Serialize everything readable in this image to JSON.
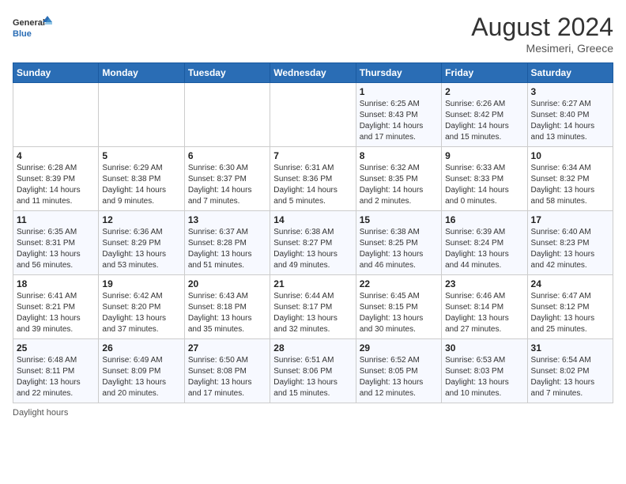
{
  "header": {
    "logo": {
      "general": "General",
      "blue": "Blue"
    },
    "title": "August 2024",
    "location": "Mesimeri, Greece"
  },
  "days_of_week": [
    "Sunday",
    "Monday",
    "Tuesday",
    "Wednesday",
    "Thursday",
    "Friday",
    "Saturday"
  ],
  "weeks": [
    [
      {
        "day": "",
        "info": ""
      },
      {
        "day": "",
        "info": ""
      },
      {
        "day": "",
        "info": ""
      },
      {
        "day": "",
        "info": ""
      },
      {
        "day": "1",
        "info": "Sunrise: 6:25 AM\nSunset: 8:43 PM\nDaylight: 14 hours\nand 17 minutes."
      },
      {
        "day": "2",
        "info": "Sunrise: 6:26 AM\nSunset: 8:42 PM\nDaylight: 14 hours\nand 15 minutes."
      },
      {
        "day": "3",
        "info": "Sunrise: 6:27 AM\nSunset: 8:40 PM\nDaylight: 14 hours\nand 13 minutes."
      }
    ],
    [
      {
        "day": "4",
        "info": "Sunrise: 6:28 AM\nSunset: 8:39 PM\nDaylight: 14 hours\nand 11 minutes."
      },
      {
        "day": "5",
        "info": "Sunrise: 6:29 AM\nSunset: 8:38 PM\nDaylight: 14 hours\nand 9 minutes."
      },
      {
        "day": "6",
        "info": "Sunrise: 6:30 AM\nSunset: 8:37 PM\nDaylight: 14 hours\nand 7 minutes."
      },
      {
        "day": "7",
        "info": "Sunrise: 6:31 AM\nSunset: 8:36 PM\nDaylight: 14 hours\nand 5 minutes."
      },
      {
        "day": "8",
        "info": "Sunrise: 6:32 AM\nSunset: 8:35 PM\nDaylight: 14 hours\nand 2 minutes."
      },
      {
        "day": "9",
        "info": "Sunrise: 6:33 AM\nSunset: 8:33 PM\nDaylight: 14 hours\nand 0 minutes."
      },
      {
        "day": "10",
        "info": "Sunrise: 6:34 AM\nSunset: 8:32 PM\nDaylight: 13 hours\nand 58 minutes."
      }
    ],
    [
      {
        "day": "11",
        "info": "Sunrise: 6:35 AM\nSunset: 8:31 PM\nDaylight: 13 hours\nand 56 minutes."
      },
      {
        "day": "12",
        "info": "Sunrise: 6:36 AM\nSunset: 8:29 PM\nDaylight: 13 hours\nand 53 minutes."
      },
      {
        "day": "13",
        "info": "Sunrise: 6:37 AM\nSunset: 8:28 PM\nDaylight: 13 hours\nand 51 minutes."
      },
      {
        "day": "14",
        "info": "Sunrise: 6:38 AM\nSunset: 8:27 PM\nDaylight: 13 hours\nand 49 minutes."
      },
      {
        "day": "15",
        "info": "Sunrise: 6:38 AM\nSunset: 8:25 PM\nDaylight: 13 hours\nand 46 minutes."
      },
      {
        "day": "16",
        "info": "Sunrise: 6:39 AM\nSunset: 8:24 PM\nDaylight: 13 hours\nand 44 minutes."
      },
      {
        "day": "17",
        "info": "Sunrise: 6:40 AM\nSunset: 8:23 PM\nDaylight: 13 hours\nand 42 minutes."
      }
    ],
    [
      {
        "day": "18",
        "info": "Sunrise: 6:41 AM\nSunset: 8:21 PM\nDaylight: 13 hours\nand 39 minutes."
      },
      {
        "day": "19",
        "info": "Sunrise: 6:42 AM\nSunset: 8:20 PM\nDaylight: 13 hours\nand 37 minutes."
      },
      {
        "day": "20",
        "info": "Sunrise: 6:43 AM\nSunset: 8:18 PM\nDaylight: 13 hours\nand 35 minutes."
      },
      {
        "day": "21",
        "info": "Sunrise: 6:44 AM\nSunset: 8:17 PM\nDaylight: 13 hours\nand 32 minutes."
      },
      {
        "day": "22",
        "info": "Sunrise: 6:45 AM\nSunset: 8:15 PM\nDaylight: 13 hours\nand 30 minutes."
      },
      {
        "day": "23",
        "info": "Sunrise: 6:46 AM\nSunset: 8:14 PM\nDaylight: 13 hours\nand 27 minutes."
      },
      {
        "day": "24",
        "info": "Sunrise: 6:47 AM\nSunset: 8:12 PM\nDaylight: 13 hours\nand 25 minutes."
      }
    ],
    [
      {
        "day": "25",
        "info": "Sunrise: 6:48 AM\nSunset: 8:11 PM\nDaylight: 13 hours\nand 22 minutes."
      },
      {
        "day": "26",
        "info": "Sunrise: 6:49 AM\nSunset: 8:09 PM\nDaylight: 13 hours\nand 20 minutes."
      },
      {
        "day": "27",
        "info": "Sunrise: 6:50 AM\nSunset: 8:08 PM\nDaylight: 13 hours\nand 17 minutes."
      },
      {
        "day": "28",
        "info": "Sunrise: 6:51 AM\nSunset: 8:06 PM\nDaylight: 13 hours\nand 15 minutes."
      },
      {
        "day": "29",
        "info": "Sunrise: 6:52 AM\nSunset: 8:05 PM\nDaylight: 13 hours\nand 12 minutes."
      },
      {
        "day": "30",
        "info": "Sunrise: 6:53 AM\nSunset: 8:03 PM\nDaylight: 13 hours\nand 10 minutes."
      },
      {
        "day": "31",
        "info": "Sunrise: 6:54 AM\nSunset: 8:02 PM\nDaylight: 13 hours\nand 7 minutes."
      }
    ]
  ],
  "footer": {
    "note": "Daylight hours"
  }
}
